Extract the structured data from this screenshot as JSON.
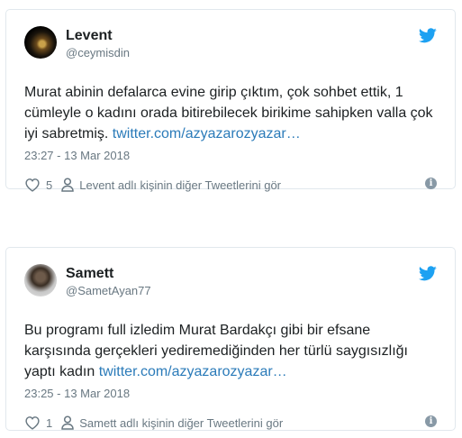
{
  "tweets": [
    {
      "name": "Levent",
      "handle": "@ceymisdin",
      "text": "Murat abinin defalarca evine girip çıktım, çok sohbet ettik, 1 cümleyle o kadını orada bitirebilecek birikime sahipken valla çok iyi sabretmiş. ",
      "link": "twitter.com/azyazarozyazar…",
      "datetime": "23:27 - 13 Mar 2018",
      "likes": "5",
      "more_label": "Levent adlı kişinin diğer Tweetlerini gör"
    },
    {
      "name": "Samett",
      "handle": "@SametAyan77",
      "text": "Bu programı full izledim Murat Bardakçı gibi bir efsane karşısında gerçekleri yediremediğinden her türlü saygısızlığı yaptı kadın ",
      "link": "twitter.com/azyazarozyazar…",
      "datetime": "23:25 - 13 Mar 2018",
      "likes": "1",
      "more_label": "Samett adlı kişinin diğer Tweetlerini gör"
    }
  ],
  "colors": {
    "link": "#2b7bb9",
    "twitter_blue": "#1da1f2",
    "meta": "#697882",
    "border": "#e1e8ed"
  },
  "icons": {
    "brand": "twitter-bird-icon",
    "like": "heart-icon",
    "profile": "person-icon",
    "info": "info-icon"
  }
}
